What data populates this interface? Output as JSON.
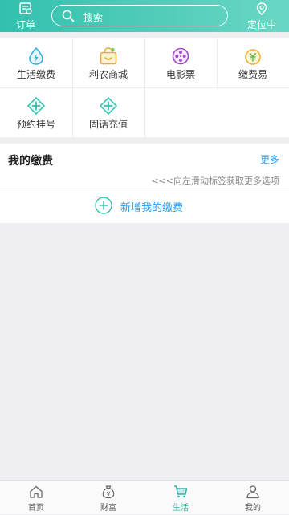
{
  "header": {
    "orders_label": "订单",
    "search_placeholder": "搜索",
    "location_label": "定位中"
  },
  "services": [
    {
      "label": "生活缴费",
      "icon": "water-drop-icon"
    },
    {
      "label": "利农商城",
      "icon": "shopping-basket-icon"
    },
    {
      "label": "电影票",
      "icon": "film-reel-icon"
    },
    {
      "label": "缴费易",
      "icon": "yuan-coin-icon"
    },
    {
      "label": "预约挂号",
      "icon": "medical-cross-icon"
    },
    {
      "label": "固话充值",
      "icon": "medical-cross-icon"
    }
  ],
  "payment": {
    "title": "我的缴费",
    "more_label": "更多",
    "hint": "<<<向左滑动标签获取更多选项",
    "add_label": "新增我的缴费"
  },
  "tabs": [
    {
      "label": "首页",
      "icon": "home-icon",
      "active": false
    },
    {
      "label": "财富",
      "icon": "money-bag-icon",
      "active": false
    },
    {
      "label": "生活",
      "icon": "shopping-cart-icon",
      "active": true
    },
    {
      "label": "我的",
      "icon": "user-icon",
      "active": false
    }
  ],
  "colors": {
    "header_start": "#33c0ae",
    "header_end": "#6ad7c4",
    "link_blue": "#2a9df4",
    "active_tab": "#2fb2a5"
  }
}
